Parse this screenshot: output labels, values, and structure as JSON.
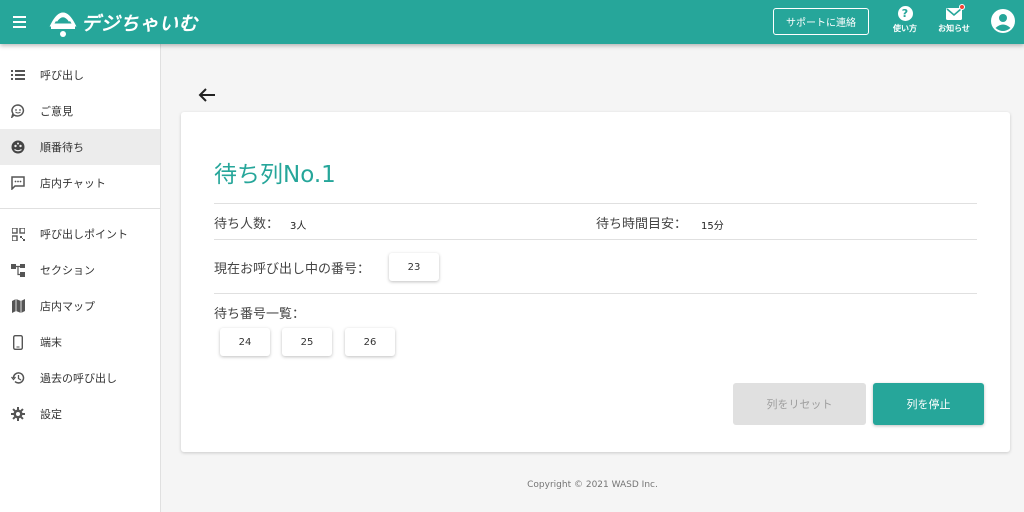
{
  "header": {
    "app_name": "デジちゃいむ",
    "contact_label": "サポートに連絡",
    "help_label": "使い方",
    "notice_label": "お知らせ"
  },
  "sidebar": {
    "items": [
      {
        "label": "呼び出し",
        "icon": "list-icon"
      },
      {
        "label": "ご意見",
        "icon": "feedback-icon"
      },
      {
        "label": "順番待ち",
        "icon": "queue-icon",
        "active": true
      },
      {
        "label": "店内チャット",
        "icon": "chat-icon"
      },
      {
        "label": "呼び出しポイント",
        "icon": "qr-code-icon"
      },
      {
        "label": "セクション",
        "icon": "sections-icon"
      },
      {
        "label": "店内マップ",
        "icon": "map-icon"
      },
      {
        "label": "端末",
        "icon": "phone-icon"
      },
      {
        "label": "過去の呼び出し",
        "icon": "history-icon"
      },
      {
        "label": "設定",
        "icon": "gear-icon"
      }
    ]
  },
  "queue": {
    "title": "待ち列No.1",
    "waiting_count_label": "待ち人数：",
    "waiting_count_value": "3人",
    "wait_time_label": "待ち時間目安：",
    "wait_time_value": "15分",
    "current_label": "現在お呼び出し中の番号：",
    "current_number": "23",
    "list_label": "待ち番号一覧：",
    "numbers": [
      "24",
      "25",
      "26"
    ],
    "reset_label": "列をリセット",
    "stop_label": "列を停止"
  },
  "footer": {
    "copyright": "Copyright © 2021 WASD Inc."
  },
  "colors": {
    "primary": "#26a69a",
    "notification_dot": "#f44336"
  }
}
